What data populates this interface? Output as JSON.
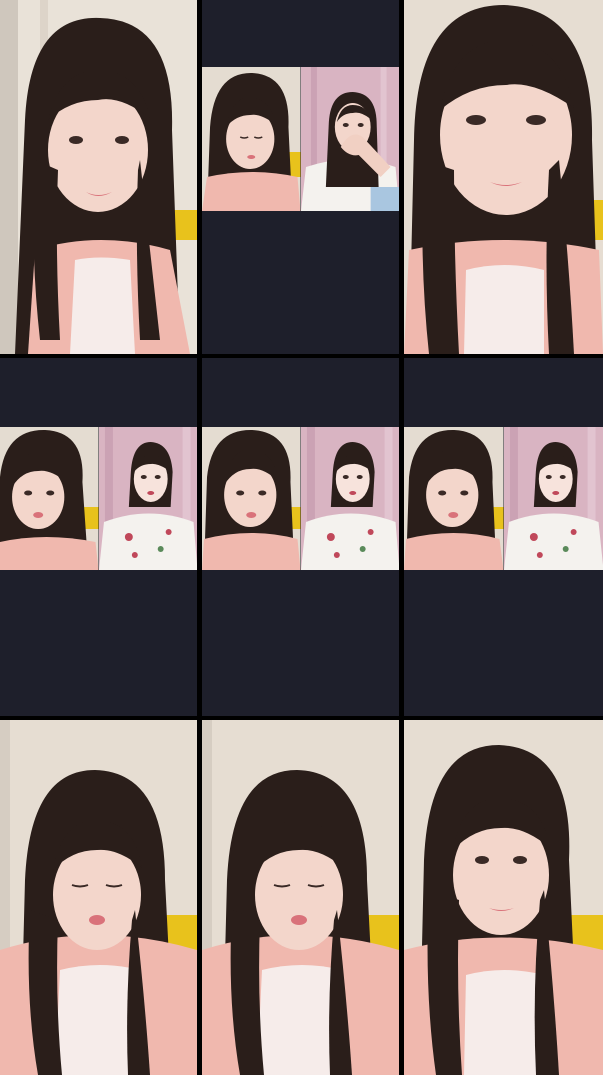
{
  "grid": {
    "background": "#000000",
    "tile_dark": "#1e1f2b",
    "tiles": [
      {
        "kind": "solo",
        "scene": "girl-pink-top-smiling-at-camera"
      },
      {
        "kind": "duo",
        "scene": "girl-looking-down-and-woman-covering-face-with-hand"
      },
      {
        "kind": "solo",
        "scene": "girl-close-up-facing-camera"
      },
      {
        "kind": "duo",
        "scene": "girl-and-woman-in-white-floral-blouse"
      },
      {
        "kind": "duo",
        "scene": "girl-and-woman-in-white-floral-blouse"
      },
      {
        "kind": "duo",
        "scene": "girl-and-woman-in-white-floral-blouse"
      },
      {
        "kind": "solo",
        "scene": "girl-pouting-pink-top"
      },
      {
        "kind": "solo",
        "scene": "girl-pouting-pink-top"
      },
      {
        "kind": "solo",
        "scene": "girl-neutral-face-pink-top"
      }
    ]
  },
  "colors": {
    "curtain": "#e6ddd2",
    "hair": "#2a1e1a",
    "skin": "#f3d6cb",
    "pink_top": "#f0b8ae",
    "white_blouse": "#f4f2ee",
    "yellow_sofa": "#e8c21c",
    "pink_wall": "#d9b4c2"
  }
}
